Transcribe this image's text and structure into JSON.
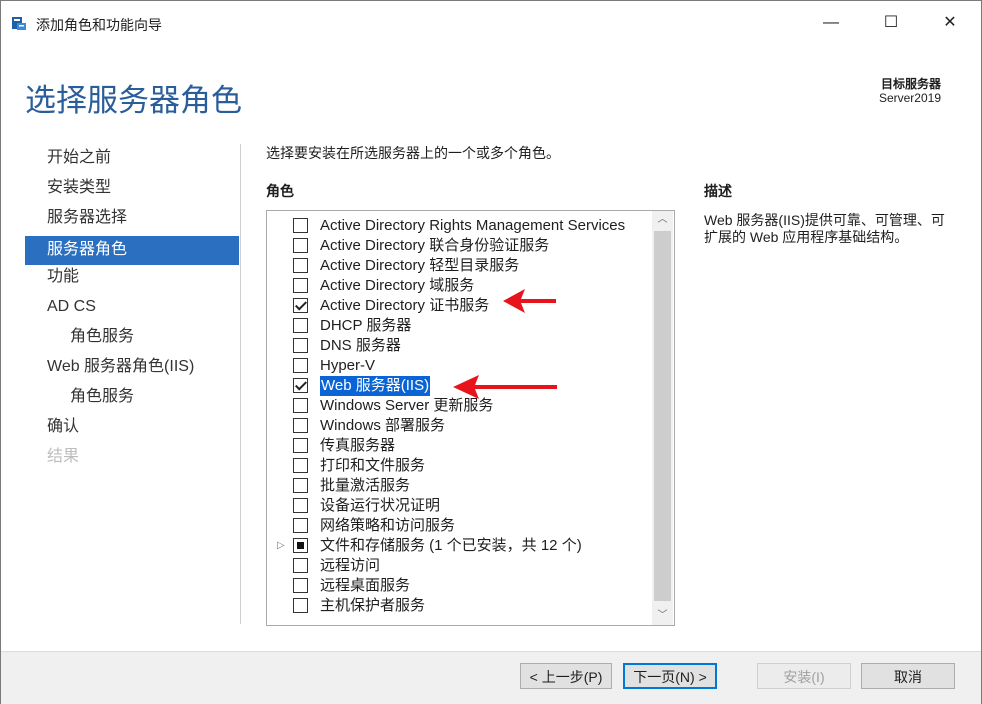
{
  "window": {
    "title": "添加角色和功能向导",
    "minimize_glyph": "—",
    "maximize_glyph": "☐",
    "close_glyph": "✕"
  },
  "header": {
    "page_title": "选择服务器角色",
    "target_label": "目标服务器",
    "target_value": "Server2019"
  },
  "nav": {
    "items": [
      {
        "label": "开始之前",
        "state": "normal"
      },
      {
        "label": "安装类型",
        "state": "normal"
      },
      {
        "label": "服务器选择",
        "state": "normal"
      },
      {
        "label": "服务器角色",
        "state": "active"
      },
      {
        "label": "功能",
        "state": "normal"
      },
      {
        "label": "AD CS",
        "state": "normal"
      },
      {
        "label": "角色服务",
        "state": "sub"
      },
      {
        "label": "Web 服务器角色(IIS)",
        "state": "normal"
      },
      {
        "label": "角色服务",
        "state": "sub"
      },
      {
        "label": "确认",
        "state": "normal"
      },
      {
        "label": "结果",
        "state": "disabled"
      }
    ]
  },
  "main": {
    "instruction": "选择要安装在所选服务器上的一个或多个角色。",
    "roles_label": "角色",
    "roles": [
      {
        "label": "Active Directory Rights Management Services",
        "checked": false
      },
      {
        "label": "Active Directory 联合身份验证服务",
        "checked": false
      },
      {
        "label": "Active Directory 轻型目录服务",
        "checked": false
      },
      {
        "label": "Active Directory 域服务",
        "checked": false
      },
      {
        "label": "Active Directory 证书服务",
        "checked": true
      },
      {
        "label": "DHCP 服务器",
        "checked": false
      },
      {
        "label": "DNS 服务器",
        "checked": false
      },
      {
        "label": "Hyper-V",
        "checked": false
      },
      {
        "label": "Web 服务器(IIS)",
        "checked": true,
        "selected": true
      },
      {
        "label": "Windows Server 更新服务",
        "checked": false
      },
      {
        "label": "Windows 部署服务",
        "checked": false
      },
      {
        "label": "传真服务器",
        "checked": false
      },
      {
        "label": "打印和文件服务",
        "checked": false
      },
      {
        "label": "批量激活服务",
        "checked": false
      },
      {
        "label": "设备运行状况证明",
        "checked": false
      },
      {
        "label": "网络策略和访问服务",
        "checked": false
      },
      {
        "label": "文件和存储服务 (1 个已安装，共 12 个)",
        "checked": "partial",
        "expandable": true
      },
      {
        "label": "远程访问",
        "checked": false
      },
      {
        "label": "远程桌面服务",
        "checked": false
      },
      {
        "label": "主机保护者服务",
        "checked": false
      }
    ]
  },
  "description": {
    "label": "描述",
    "text": "Web 服务器(IIS)提供可靠、可管理、可扩展的 Web 应用程序基础结构。"
  },
  "footer": {
    "prev_label": "< 上一步(P)",
    "next_label": "下一页(N) >",
    "install_label": "安装(I)",
    "cancel_label": "取消"
  },
  "colors": {
    "accent": "#2a6fc0",
    "title_blue": "#2a5e9a",
    "selection": "#0a64d6",
    "annotation_arrow": "#e8141b"
  },
  "icons": {
    "app": "server-manager-icon",
    "expand": "expand-triangle-icon",
    "scroll_up": "chevron-up-icon",
    "scroll_down": "chevron-down-icon"
  }
}
